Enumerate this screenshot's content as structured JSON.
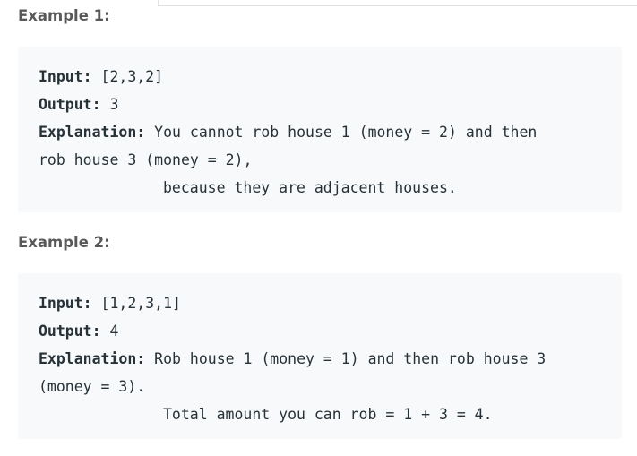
{
  "examples": [
    {
      "heading": "Example 1:",
      "input_label": "Input:",
      "input_value": " [2,3,2]",
      "output_label": "Output:",
      "output_value": " 3",
      "explanation_label": "Explanation:",
      "explanation_line1": " You cannot rob house 1 (money = 2) and then",
      "explanation_line2": "rob house 3 (money = 2),",
      "explanation_line3": "because they are adjacent houses."
    },
    {
      "heading": "Example 2:",
      "input_label": "Input:",
      "input_value": " [1,2,3,1]",
      "output_label": "Output:",
      "output_value": " 4",
      "explanation_label": "Explanation:",
      "explanation_line1": " Rob house 1 (money = 1) and then rob house 3",
      "explanation_line2": "(money = 3).",
      "explanation_line3": "Total amount you can rob = 1 + 3 = 4."
    }
  ]
}
